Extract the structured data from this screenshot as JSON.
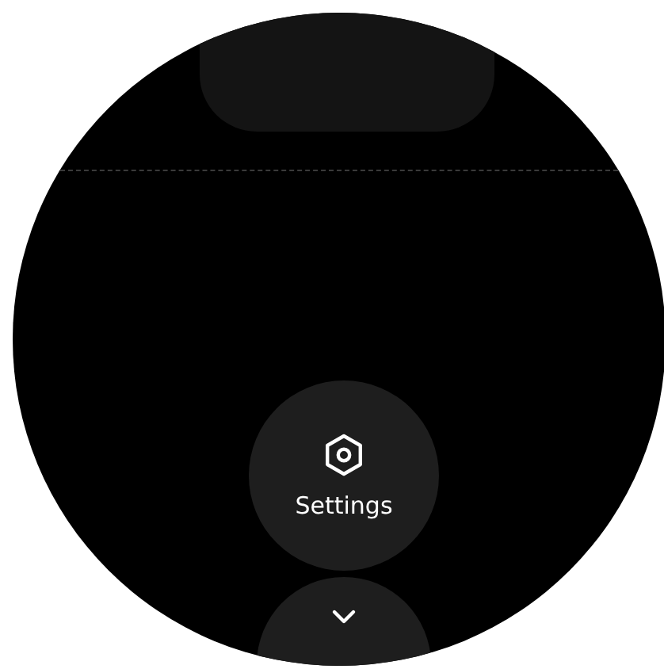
{
  "settings_button": {
    "label": "Settings"
  }
}
